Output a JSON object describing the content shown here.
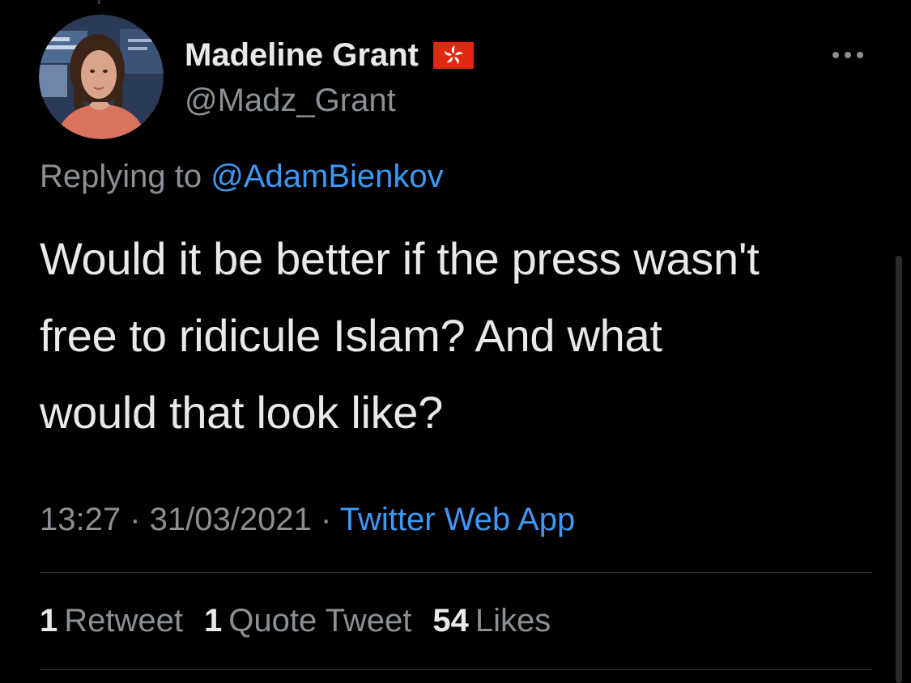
{
  "author": {
    "display_name": "Madeline Grant",
    "handle": "@Madz_Grant",
    "flag_icon": "hong-kong-flag-icon",
    "avatar_icon": "profile-photo"
  },
  "reply": {
    "prefix": "Replying to",
    "mention": "@AdamBienkov"
  },
  "tweet": {
    "text_lines": [
      "Would it be better if the press wasn't",
      "free to ridicule Islam? And what",
      "would that look like?"
    ]
  },
  "meta": {
    "time": "13:27",
    "separator": "·",
    "date": "31/03/2021",
    "source": "Twitter Web App"
  },
  "stats": {
    "retweets_count": "1",
    "retweets_label": "Retweet",
    "quotes_count": "1",
    "quotes_label": "Quote Tweet",
    "likes_count": "54",
    "likes_label": "Likes"
  },
  "colors": {
    "background": "#000000",
    "text_primary": "#e7e9ea",
    "text_secondary": "#8b9095",
    "link": "#3d99f5",
    "flag_red": "#de2910",
    "divider": "#2c2f33"
  }
}
